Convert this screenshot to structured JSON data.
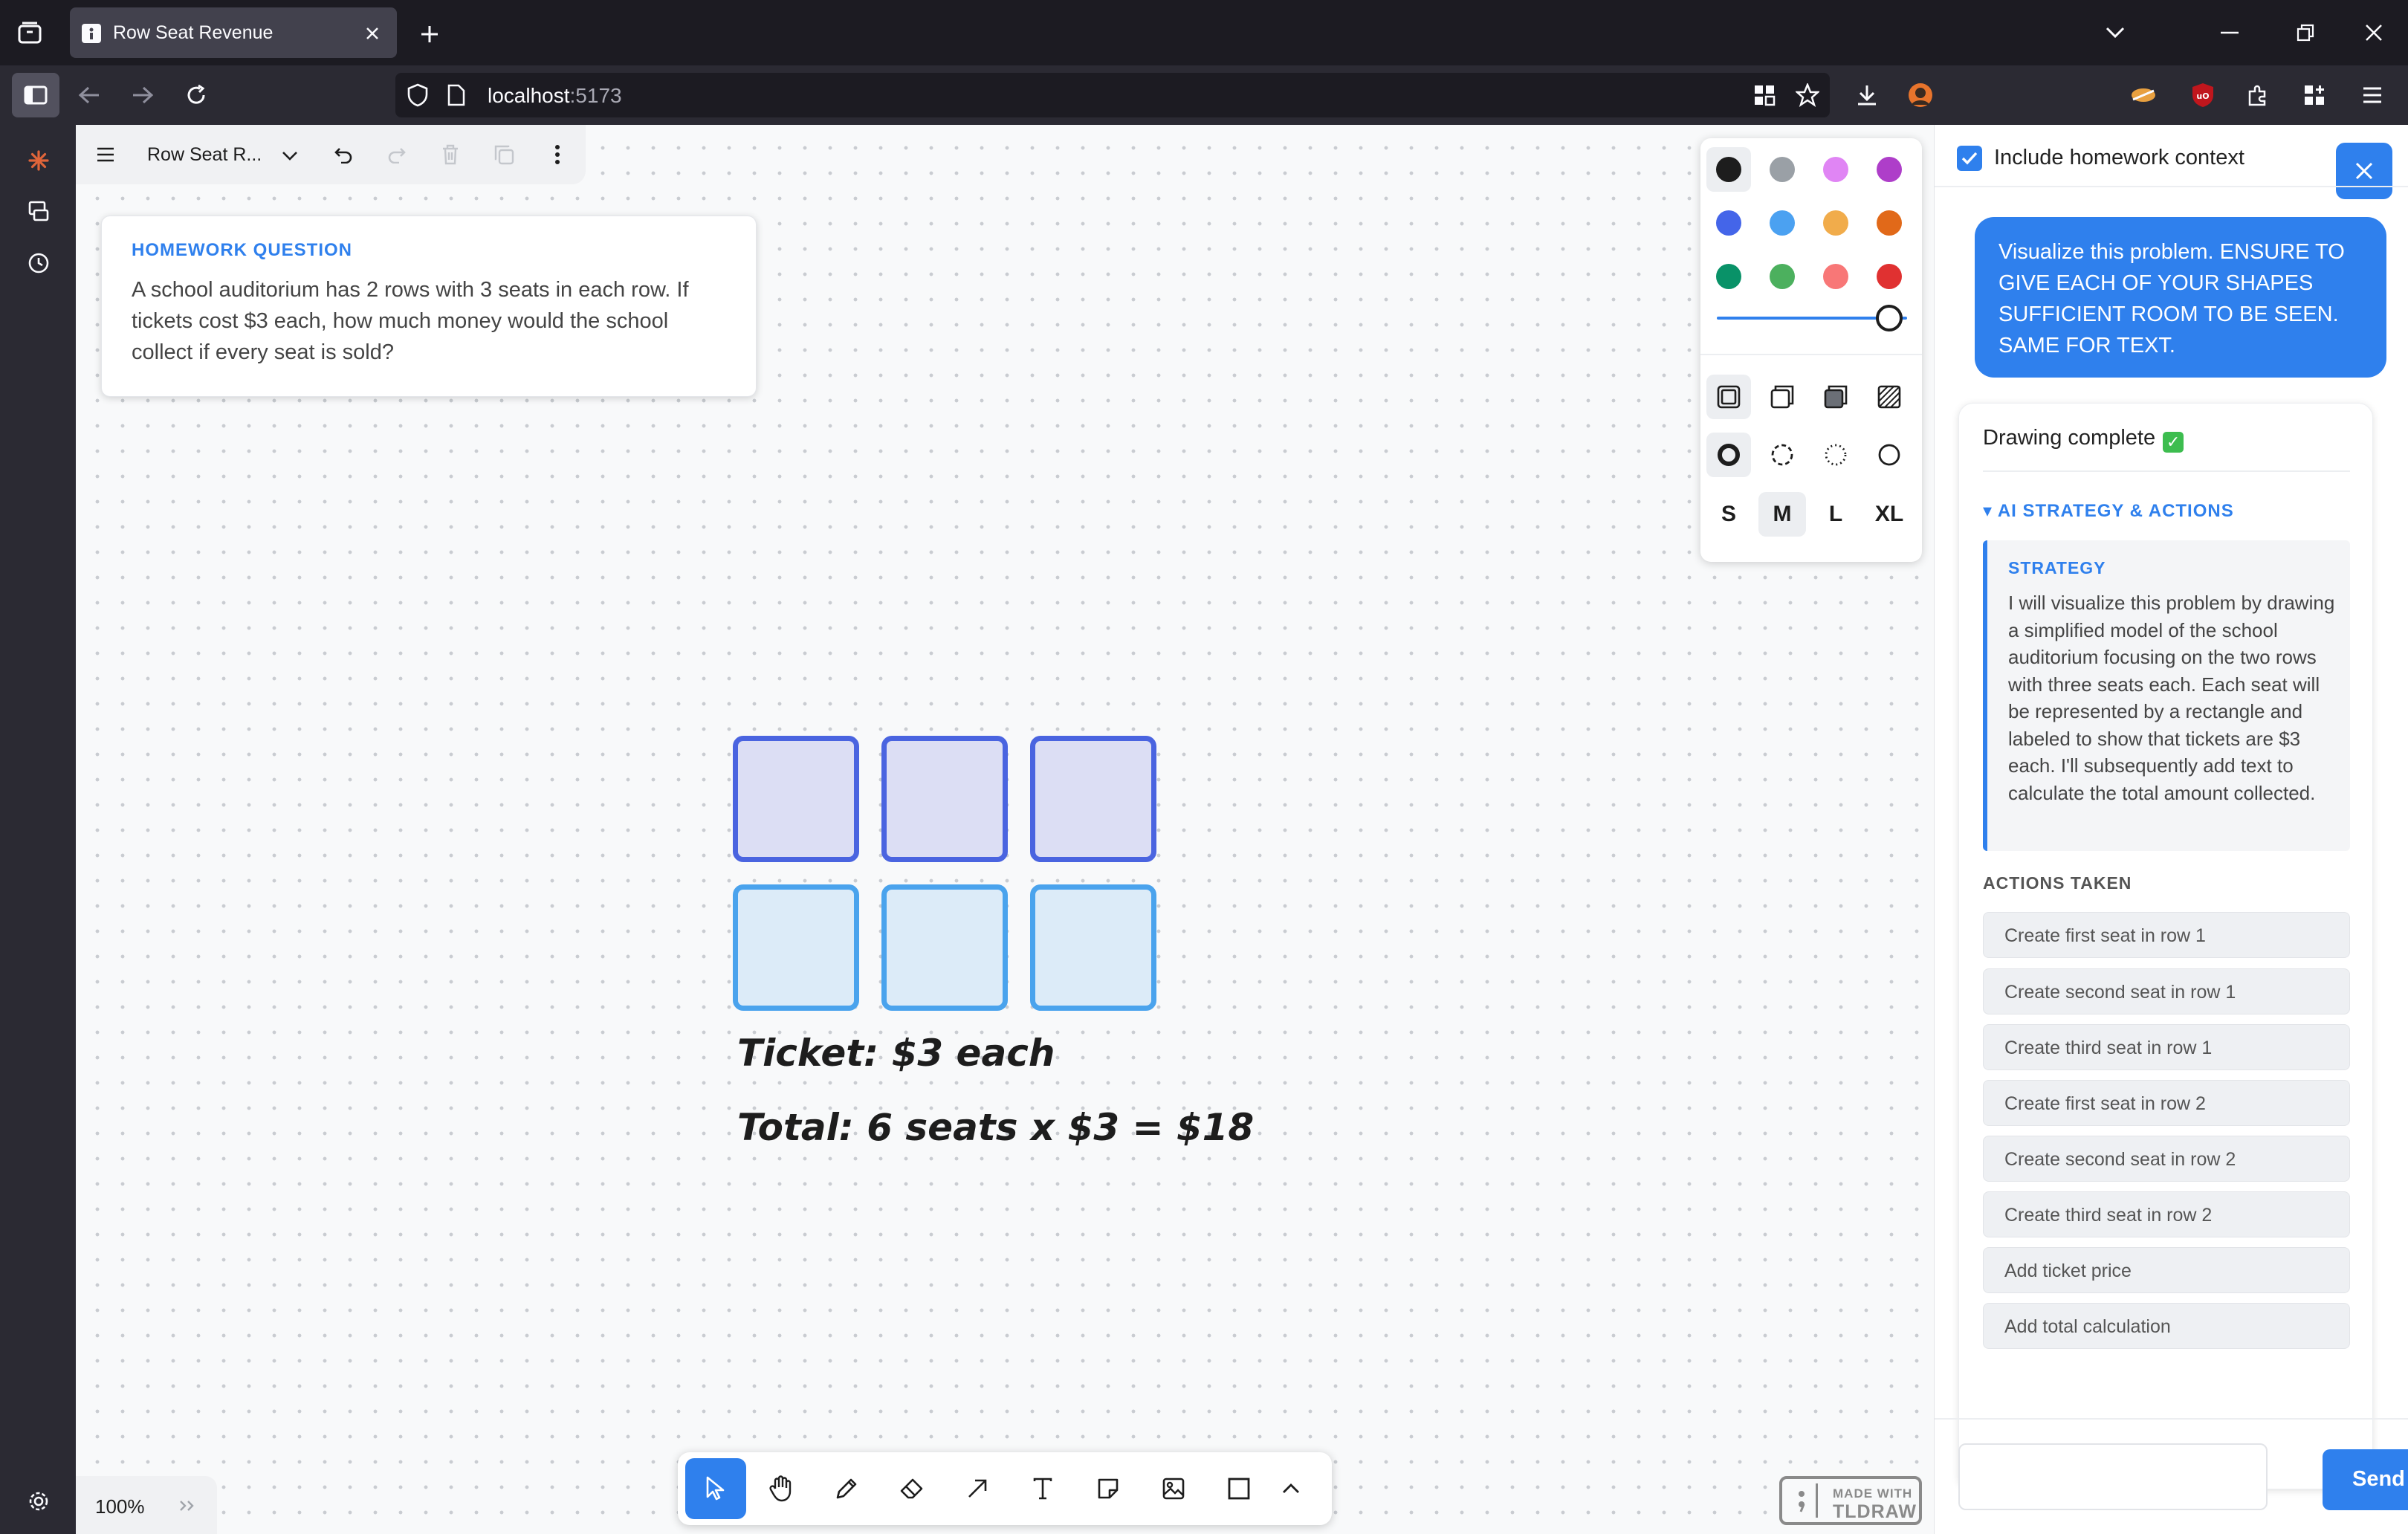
{
  "browser": {
    "tab_title": "Row Seat Revenue",
    "url_host": "localhost",
    "url_port": ":5173"
  },
  "app": {
    "doc_name": "Row Seat R...",
    "zoom": "100%"
  },
  "homework": {
    "label": "HOMEWORK QUESTION",
    "text": "A school auditorium has 2 rows with 3 seats in each row. If tickets cost $3 each, how much money would the school collect if every seat is sold?"
  },
  "style_panel": {
    "colors": [
      "#1d1d1d",
      "#9aa0a6",
      "#e085f4",
      "#ae3ec9",
      "#4465e9",
      "#4ba1f1",
      "#f1ac4b",
      "#e16919",
      "#099268",
      "#4cb05e",
      "#f87777",
      "#e03131"
    ],
    "selected_color": "#1d1d1d",
    "opacity": 1,
    "sizes": [
      "S",
      "M",
      "L",
      "XL"
    ],
    "selected_size": "M"
  },
  "canvas_text": {
    "ticket": "Ticket: $3 each",
    "total": "Total: 6 seats x $3 = $18"
  },
  "badge": {
    "made_with": "MADE WITH",
    "name": "TLDRAW"
  },
  "panel": {
    "include_context_label": "Include homework context",
    "include_context_checked": true,
    "user_message": "Visualize this problem. ENSURE TO GIVE EACH OF YOUR SHAPES SUFFICIENT ROOM TO BE SEEN. SAME FOR TEXT.",
    "status": "Drawing complete",
    "strategy_toggle": "▾ AI STRATEGY & ACTIONS",
    "strategy_label": "STRATEGY",
    "strategy_text": "I will visualize this problem by drawing a simplified model of the school auditorium focusing on the two rows with three seats each. Each seat will be represented by a rectangle and labeled to show that tickets are $3 each. I'll subsequently add text to calculate the total amount collected.",
    "actions_label": "ACTIONS TAKEN",
    "actions": [
      "Create first seat in row 1",
      "Create second seat in row 1",
      "Create third seat in row 1",
      "Create first seat in row 2",
      "Create second seat in row 2",
      "Create third seat in row 2",
      "Add ticket price",
      "Add total calculation"
    ],
    "send_label": "Send"
  }
}
